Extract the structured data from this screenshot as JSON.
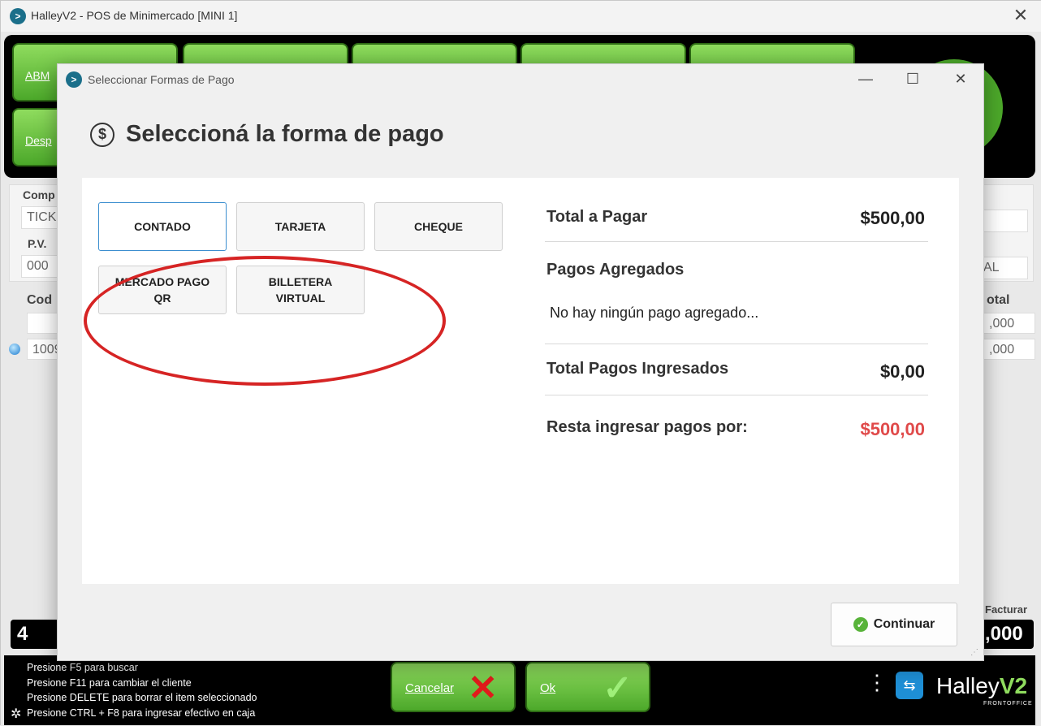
{
  "window": {
    "title": "HalleyV2 - POS de Minimercado [MINI 1]",
    "close_glyph": "✕"
  },
  "toolbar": {
    "abm_label": "ABM",
    "desp_label": "Desp"
  },
  "form": {
    "comp_label": "Comp",
    "comp_value": "TICK",
    "pv_label": "P.V.",
    "pv_value": "000",
    "cod_label": "Cod",
    "total_label": "otal",
    "row_code": "1009",
    "total_value_1": ",000",
    "total_value_2": ",000",
    "right_field": "AL",
    "facturar_label": "Facturar",
    "facturar_value": ",000",
    "left_big_value": "4"
  },
  "footer": {
    "hints": [
      "Presione F5 para buscar",
      "Presione F11 para cambiar el cliente",
      "Presione DELETE para borrar el item seleccionado",
      "Presione CTRL + F8 para ingresar efectivo en caja"
    ],
    "cancel_label": "Cancelar",
    "ok_label": "Ok",
    "brand_name": "Halley",
    "brand_version": "V2",
    "brand_sub": "FRONTOFFICE"
  },
  "dialog": {
    "title": "Seleccionar Formas de Pago",
    "heading": "Seleccioná la forma de pago",
    "payment_methods": [
      {
        "label": "CONTADO",
        "selected": true
      },
      {
        "label": "TARJETA",
        "selected": false
      },
      {
        "label": "CHEQUE",
        "selected": false
      },
      {
        "label": "MERCADO PAGO QR",
        "selected": false
      },
      {
        "label": "BILLETERA VIRTUAL",
        "selected": false
      }
    ],
    "summary": {
      "total_label": "Total a Pagar",
      "total_value": "$500,00",
      "added_label": "Pagos Agregados",
      "empty_text": "No hay ningún pago agregado...",
      "entered_label": "Total Pagos Ingresados",
      "entered_value": "$0,00",
      "remaining_label": "Resta ingresar pagos por:",
      "remaining_value": "$500,00"
    },
    "continue_label": "Continuar"
  },
  "colors": {
    "accent_green": "#4ca82a",
    "remaining_red": "#e04a4a",
    "selected_border": "#3b8ecf",
    "annotation_red": "#d62424"
  }
}
